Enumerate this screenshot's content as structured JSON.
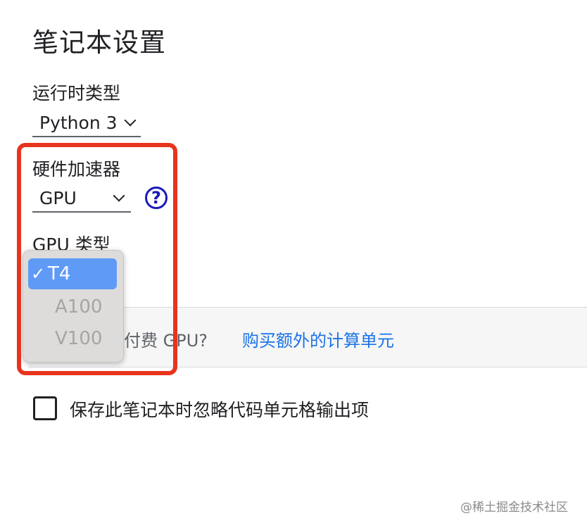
{
  "dialog": {
    "title": "笔记本设置",
    "runtime": {
      "label": "运行时类型",
      "value": "Python 3"
    },
    "hardware": {
      "label": "硬件加速器",
      "value": "GPU",
      "help_icon": "?"
    },
    "gpu_type": {
      "label": "GPU 类型",
      "options": [
        {
          "label": "T4",
          "selected": true,
          "enabled": true,
          "check": "✓"
        },
        {
          "label": "A100",
          "selected": false,
          "enabled": false
        },
        {
          "label": "V100",
          "selected": false,
          "enabled": false
        }
      ]
    },
    "paid_banner": {
      "text": "付费 GPU?",
      "link": "购买额外的计算单元"
    },
    "omit_output": {
      "label": "保存此笔记本时忽略代码单元格输出项",
      "checked": false
    }
  },
  "watermark": "@稀土掘金技术社区",
  "colors": {
    "highlight_box": "#e8331d",
    "selected_option": "#5f9bf6",
    "link": "#1a73e8"
  }
}
